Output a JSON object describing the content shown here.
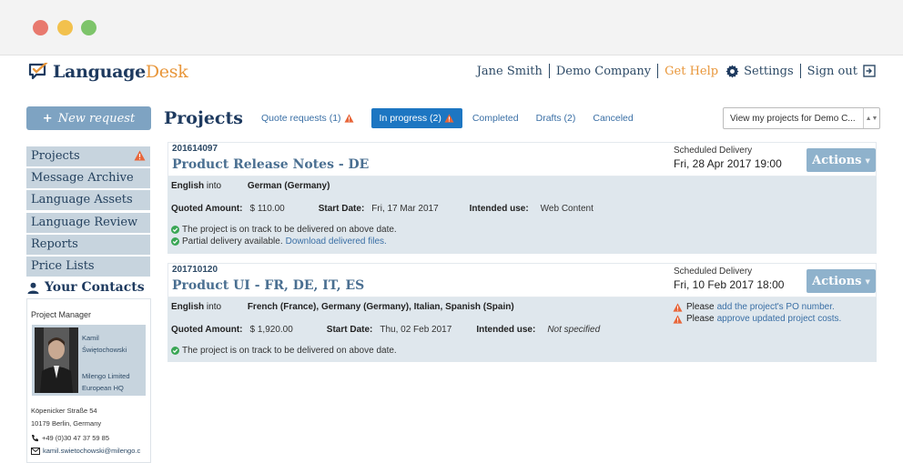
{
  "brand": {
    "name_bold": "Language",
    "name_light": "Desk"
  },
  "topnav": {
    "user": "Jane Smith",
    "company": "Demo Company",
    "help": "Get Help",
    "settings": "Settings",
    "signout": "Sign out"
  },
  "sidebar": {
    "new_request": "New request",
    "items": [
      {
        "label": "Projects"
      },
      {
        "label": "Message Archive"
      },
      {
        "label": "Language Assets"
      },
      {
        "label": "Language Review"
      },
      {
        "label": "Reports"
      },
      {
        "label": "Price Lists"
      }
    ],
    "contacts_title": "Your Contacts",
    "contact": {
      "role": "Project Manager",
      "first_name": "Kamil",
      "last_name": "Świętochowski",
      "company_line1": "Milengo Limited",
      "company_line2": "European HQ",
      "address_line1": "Köpenicker Straße 54",
      "address_line2": "10179 Berlin, Germany",
      "phone": "+49 (0)30 47 37 59 85",
      "email": "kamil.swietochowski@milengo.c"
    }
  },
  "main": {
    "title": "Projects",
    "tabs": [
      {
        "label": "Quote requests (1)"
      },
      {
        "label": "In progress (2)"
      },
      {
        "label": "Completed"
      },
      {
        "label": "Drafts (2)"
      },
      {
        "label": "Canceled"
      }
    ],
    "view_select": "View my projects for Demo C...",
    "projects": [
      {
        "id": "201614097",
        "name": "Product Release Notes - DE",
        "sched_label": "Scheduled Delivery",
        "sched_date": "Fri, 28 Apr 2017 19:00",
        "actions": "Actions",
        "source_lang": "English",
        "into": "into",
        "target_langs": "German (Germany)",
        "quoted_label": "Quoted Amount:",
        "quoted_value": "$ 110.00",
        "start_label": "Start Date:",
        "start_value": "Fri, 17 Mar 2017",
        "use_label": "Intended use:",
        "use_value": "Web Content",
        "status1": "The project is on track to be delivered on above date.",
        "status2_text": "Partial delivery available.",
        "status2_link": "Download delivered files."
      },
      {
        "id": "201710120",
        "name": "Product UI - FR, DE, IT, ES",
        "sched_label": "Scheduled Delivery",
        "sched_date": "Fri, 10 Feb 2017 18:00",
        "actions": "Actions",
        "source_lang": "English",
        "into": "into",
        "target_langs": "French (France), Germany (Germany), Italian, Spanish (Spain)",
        "quoted_label": "Quoted Amount:",
        "quoted_value": "$ 1,920.00",
        "start_label": "Start Date:",
        "start_value": "Thu, 02 Feb 2017",
        "use_label": "Intended use:",
        "use_value": "Not specified",
        "status1": "The project is on track to be delivered on above date.",
        "warn1_text": "Please",
        "warn1_link": "add the project's PO number.",
        "warn2_text": "Please",
        "warn2_link": "approve updated project costs."
      }
    ]
  },
  "colors": {
    "accent_blue": "#1d76c2",
    "warning_orange": "#e8663a",
    "success_green": "#3aa655",
    "brand_navy": "#1e3a5f",
    "brand_orange": "#e8963a"
  }
}
